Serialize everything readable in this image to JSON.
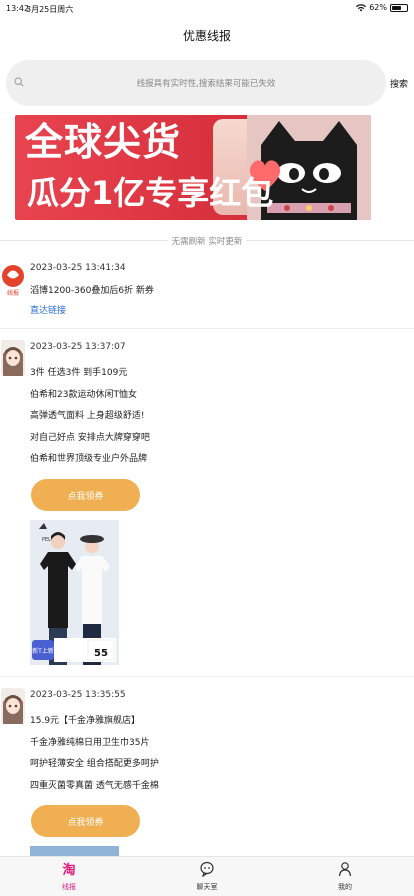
{
  "status_bar": {
    "time": "13:42",
    "date": "3月25日周六",
    "battery": "62%",
    "battery_level": 0.62
  },
  "header": {
    "title": "优惠线报"
  },
  "search": {
    "placeholder": "线报具有实时性,搜索结果可能已失效",
    "button": "搜索"
  },
  "banner": {
    "line1": "全球尖货",
    "line2": "瓜分1亿专享红包",
    "avatar_badge": "线报"
  },
  "notice": {
    "text": "无需刷新 实时更新"
  },
  "feed": [
    {
      "timestamp": "2023-03-25 13:41:34",
      "lines": [
        "滔博1200-360叠加后6折 新券"
      ],
      "link": "直达链接"
    },
    {
      "timestamp": "2023-03-25 13:37:07",
      "lines": [
        "3件 任选3件 到手109元",
        "伯希和23款运动休闲T恤女",
        "高弹透气面料 上身超级舒适!",
        "对自己好点 安排点大牌穿穿吧",
        "伯希和世界顶级专业户外品牌"
      ],
      "button": "点我领券",
      "image": {
        "brand": "PELLIOT",
        "tag": "新T上新",
        "price": "55"
      }
    },
    {
      "timestamp": "2023-03-25 13:35:55",
      "lines": [
        "15.9元【千金净雅旗舰店】",
        "千金净雅纯棉日用卫生巾35片",
        "呵护轻薄安全 组合搭配更多呵护",
        "四重灭菌零真菌 透气无感千金棉"
      ],
      "button": "点我领券"
    }
  ],
  "tab_bar": {
    "items": [
      {
        "label": "线报",
        "icon": "taobao-icon",
        "active": true
      },
      {
        "label": "聊天室",
        "icon": "chat-icon",
        "active": false
      },
      {
        "label": "我的",
        "icon": "person-icon",
        "active": false
      }
    ],
    "active_color": "#e0197d",
    "inactive_color": "#333333"
  },
  "colors": {
    "coupon_button": "#efaf52",
    "link": "#2a6fd4",
    "banner": "#d8323e"
  }
}
